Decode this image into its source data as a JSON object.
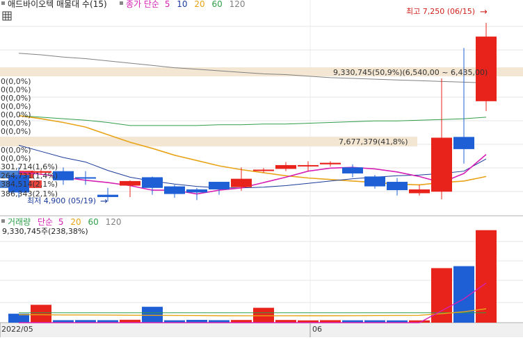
{
  "colors": {
    "up": "#e8231b",
    "down": "#1f5fd6",
    "ma5": "#d61fb4",
    "ma10": "#1a3a9a",
    "ma20": "#e8a317",
    "ma60": "#2e9e4a",
    "ma120": "#808080",
    "grid": "#e6e6e6",
    "band": "#f3e6d3"
  },
  "price_panel": {
    "title": "애드바이오텍 매물대 수(15)",
    "ma_legend": [
      {
        "label": "종가 단순",
        "color": "#d61fb4"
      },
      {
        "label": "5",
        "color": "#d61fb4"
      },
      {
        "label": "10",
        "color": "#1a3a9a"
      },
      {
        "label": "20",
        "color": "#e8a317"
      },
      {
        "label": "60",
        "color": "#2e9e4a"
      },
      {
        "label": "120",
        "color": "#808080"
      }
    ],
    "high_label": "최고 7,250 (06/15)",
    "high_arrow": "→",
    "low_label": "최저 4,900 (05/19)",
    "low_arrow": "→",
    "profile_labels": [
      "0(0,0%)",
      "0(0,0%)",
      "0(0,0%)",
      "0(0,0%)",
      "0(0,0%)",
      "0(0,0%)",
      "0(0,0%)",
      "0(0,0%)",
      "0(0,0%)",
      "301,714(1,6%)",
      "264,731(1,4%)",
      "384,514(2,1%)",
      "386,343(2,1%)"
    ],
    "band_top_label": "9,330,745(50,9%)(6,540,00 ~ 6,435,00)",
    "band_mid_label": "7,677,379(41,8%)"
  },
  "volume_panel": {
    "legend": [
      {
        "label": "거래량",
        "color": "#2e9e4a"
      },
      {
        "label": "단순",
        "color": "#d61fb4"
      },
      {
        "label": "5",
        "color": "#d61fb4"
      },
      {
        "label": "20",
        "color": "#e8a317"
      },
      {
        "label": "60",
        "color": "#2e9e4a"
      },
      {
        "label": "120",
        "color": "#808080"
      }
    ],
    "volume_label": "9,330,745주(238,38%)"
  },
  "x_axis": {
    "labels": [
      "2022/05",
      "06"
    ]
  },
  "chart_data": {
    "type": "candlestick",
    "title": "애드바이오텍 매물대 수(15)",
    "ylim": [
      4850,
      7350
    ],
    "candles": [
      {
        "open": 5250,
        "close": 5020,
        "high": 5350,
        "low": 4950
      },
      {
        "open": 5280,
        "close": 5300,
        "high": 5320,
        "low": 5250
      },
      {
        "open": 5300,
        "close": 5180,
        "high": 5350,
        "low": 5120
      },
      {
        "open": 5220,
        "close": 5210,
        "high": 5300,
        "low": 5120
      },
      {
        "open": 4990,
        "close": 4960,
        "high": 5080,
        "low": 4900
      },
      {
        "open": 5110,
        "close": 5170,
        "high": 5180,
        "low": 4960
      },
      {
        "open": 5220,
        "close": 5080,
        "high": 5230,
        "low": 4990
      },
      {
        "open": 5100,
        "close": 5000,
        "high": 5120,
        "low": 4950
      },
      {
        "open": 5060,
        "close": 5020,
        "high": 5080,
        "low": 4920
      },
      {
        "open": 5160,
        "close": 5060,
        "high": 5160,
        "low": 4990
      },
      {
        "open": 5090,
        "close": 5200,
        "high": 5350,
        "low": 5040
      },
      {
        "open": 5310,
        "close": 5320,
        "high": 5340,
        "low": 5280
      },
      {
        "open": 5330,
        "close": 5380,
        "high": 5420,
        "low": 5300
      },
      {
        "open": 5370,
        "close": 5380,
        "high": 5430,
        "low": 5300
      },
      {
        "open": 5390,
        "close": 5410,
        "high": 5430,
        "low": 5360
      },
      {
        "open": 5350,
        "close": 5270,
        "high": 5390,
        "low": 5220
      },
      {
        "open": 5230,
        "close": 5100,
        "high": 5250,
        "low": 5070
      },
      {
        "open": 5160,
        "close": 5050,
        "high": 5210,
        "low": 4980
      },
      {
        "open": 5010,
        "close": 5060,
        "high": 5120,
        "low": 4980
      },
      {
        "open": 5030,
        "close": 5740,
        "high": 6520,
        "low": 4930
      },
      {
        "open": 5750,
        "close": 5590,
        "high": 6920,
        "low": 5400
      },
      {
        "open": 6220,
        "close": 7070,
        "high": 7250,
        "low": 6090
      }
    ],
    "ma5": [
      5290,
      5260,
      5220,
      5180,
      5150,
      5110,
      5050,
      5050,
      5000,
      5050,
      5080,
      5150,
      5220,
      5300,
      5340,
      5350,
      5330,
      5290,
      5230,
      5150,
      5270,
      5520
    ],
    "ma10": [
      5640,
      5560,
      5480,
      5420,
      5310,
      5220,
      5170,
      5130,
      5100,
      5080,
      5080,
      5090,
      5110,
      5140,
      5170,
      5200,
      5220,
      5240,
      5250,
      5270,
      5300,
      5460
    ],
    "ma20": [
      6030,
      5990,
      5940,
      5880,
      5780,
      5680,
      5600,
      5510,
      5440,
      5370,
      5320,
      5280,
      5240,
      5210,
      5190,
      5170,
      5150,
      5130,
      5120,
      5150,
      5170,
      5230
    ],
    "ma60": [
      6030,
      6010,
      5990,
      5970,
      5940,
      5900,
      5900,
      5900,
      5900,
      5910,
      5910,
      5920,
      5920,
      5930,
      5940,
      5950,
      5960,
      5960,
      5970,
      5980,
      5990,
      6010
    ],
    "ma120": [
      6850,
      6830,
      6800,
      6780,
      6750,
      6720,
      6690,
      6660,
      6640,
      6620,
      6600,
      6580,
      6570,
      6550,
      6530,
      6520,
      6510,
      6500,
      6490,
      6480,
      6470,
      6460
    ],
    "volume": [
      900000,
      1800000,
      250000,
      260000,
      250000,
      290000,
      1600000,
      240000,
      280000,
      250000,
      270000,
      1500000,
      270000,
      230000,
      250000,
      240000,
      240000,
      230000,
      230000,
      5500000,
      5700000,
      9330745
    ],
    "volume_ylim": [
      0,
      9800000
    ],
    "vol_ma5": [
      0,
      0,
      0,
      0,
      0,
      0,
      0,
      0,
      0,
      0,
      0,
      0,
      0,
      0,
      0,
      0,
      0,
      0,
      0,
      1200000,
      2400000,
      4000000
    ],
    "vol_ma20": [
      800000,
      800000,
      780000,
      780000,
      760000,
      750000,
      740000,
      730000,
      720000,
      700000,
      690000,
      690000,
      690000,
      700000,
      700000,
      710000,
      720000,
      730000,
      740000,
      900000,
      1100000,
      1400000
    ],
    "vol_ma60": [
      1000000,
      1000000,
      1000000,
      1000000,
      1000000,
      1000000,
      1000000,
      1000000,
      1000000,
      1000000,
      1000000,
      1000000,
      1000000,
      1000000,
      1000000,
      1000000,
      1000000,
      1000000,
      1000000,
      1000000,
      1000000,
      1000000
    ],
    "x_labels": [
      "2022/05",
      "06"
    ]
  }
}
